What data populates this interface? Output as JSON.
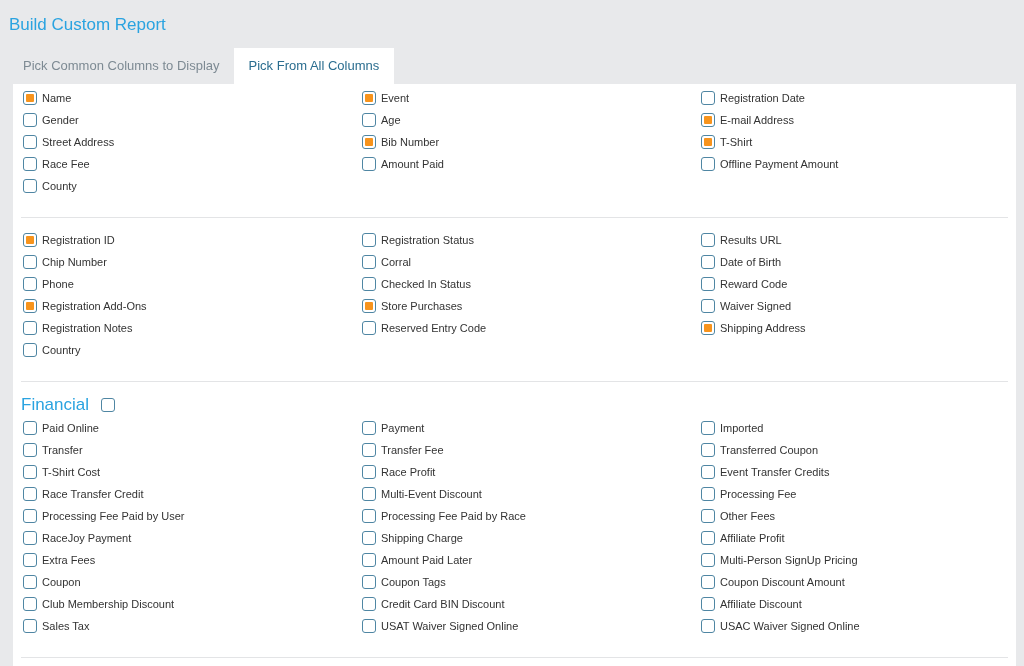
{
  "title": "Build Custom Report",
  "tabs": [
    {
      "label": "Pick Common Columns to Display",
      "selected": false
    },
    {
      "label": "Pick From All Columns",
      "selected": true
    }
  ],
  "sections": [
    {
      "items": [
        {
          "label": "Name",
          "checked": true
        },
        {
          "label": "Event",
          "checked": true
        },
        {
          "label": "Registration Date",
          "checked": false
        },
        {
          "label": "Gender",
          "checked": false
        },
        {
          "label": "Age",
          "checked": false
        },
        {
          "label": "E-mail Address",
          "checked": true
        },
        {
          "label": "Street Address",
          "checked": false
        },
        {
          "label": "Bib Number",
          "checked": true
        },
        {
          "label": "T-Shirt",
          "checked": true
        },
        {
          "label": "Race Fee",
          "checked": false
        },
        {
          "label": "Amount Paid",
          "checked": false
        },
        {
          "label": "Offline Payment Amount",
          "checked": false
        },
        {
          "label": "County",
          "checked": false
        }
      ]
    },
    {
      "items": [
        {
          "label": "Registration ID",
          "checked": true
        },
        {
          "label": "Registration Status",
          "checked": false
        },
        {
          "label": "Results URL",
          "checked": false
        },
        {
          "label": "Chip Number",
          "checked": false
        },
        {
          "label": "Corral",
          "checked": false
        },
        {
          "label": "Date of Birth",
          "checked": false
        },
        {
          "label": "Phone",
          "checked": false
        },
        {
          "label": "Checked In Status",
          "checked": false
        },
        {
          "label": "Reward Code",
          "checked": false
        },
        {
          "label": "Registration Add-Ons",
          "checked": true
        },
        {
          "label": "Store Purchases",
          "checked": true
        },
        {
          "label": "Waiver Signed",
          "checked": false
        },
        {
          "label": "Registration Notes",
          "checked": false
        },
        {
          "label": "Reserved Entry Code",
          "checked": false
        },
        {
          "label": "Shipping Address",
          "checked": true
        },
        {
          "label": "Country",
          "checked": false
        }
      ]
    },
    {
      "heading": {
        "text": "Financial",
        "checked": false
      },
      "items": [
        {
          "label": "Paid Online",
          "checked": false
        },
        {
          "label": "Payment",
          "checked": false
        },
        {
          "label": "Imported",
          "checked": false
        },
        {
          "label": "Transfer",
          "checked": false
        },
        {
          "label": "Transfer Fee",
          "checked": false
        },
        {
          "label": "Transferred Coupon",
          "checked": false
        },
        {
          "label": "T-Shirt Cost",
          "checked": false
        },
        {
          "label": "Race Profit",
          "checked": false
        },
        {
          "label": "Event Transfer Credits",
          "checked": false
        },
        {
          "label": "Race Transfer Credit",
          "checked": false
        },
        {
          "label": "Multi-Event Discount",
          "checked": false
        },
        {
          "label": "Processing Fee",
          "checked": false
        },
        {
          "label": "Processing Fee Paid by User",
          "checked": false
        },
        {
          "label": "Processing Fee Paid by Race",
          "checked": false
        },
        {
          "label": "Other Fees",
          "checked": false
        },
        {
          "label": "RaceJoy Payment",
          "checked": false
        },
        {
          "label": "Shipping Charge",
          "checked": false
        },
        {
          "label": "Affiliate Profit",
          "checked": false
        },
        {
          "label": "Extra Fees",
          "checked": false
        },
        {
          "label": "Amount Paid Later",
          "checked": false
        },
        {
          "label": "Multi-Person SignUp Pricing",
          "checked": false
        },
        {
          "label": "Coupon",
          "checked": false
        },
        {
          "label": "Coupon Tags",
          "checked": false
        },
        {
          "label": "Coupon Discount Amount",
          "checked": false
        },
        {
          "label": "Club Membership Discount",
          "checked": false
        },
        {
          "label": "Credit Card BIN Discount",
          "checked": false
        },
        {
          "label": "Affiliate Discount",
          "checked": false
        },
        {
          "label": "Sales Tax",
          "checked": false
        },
        {
          "label": "USAT Waiver Signed Online",
          "checked": false
        },
        {
          "label": "USAC Waiver Signed Online",
          "checked": false
        }
      ]
    }
  ]
}
